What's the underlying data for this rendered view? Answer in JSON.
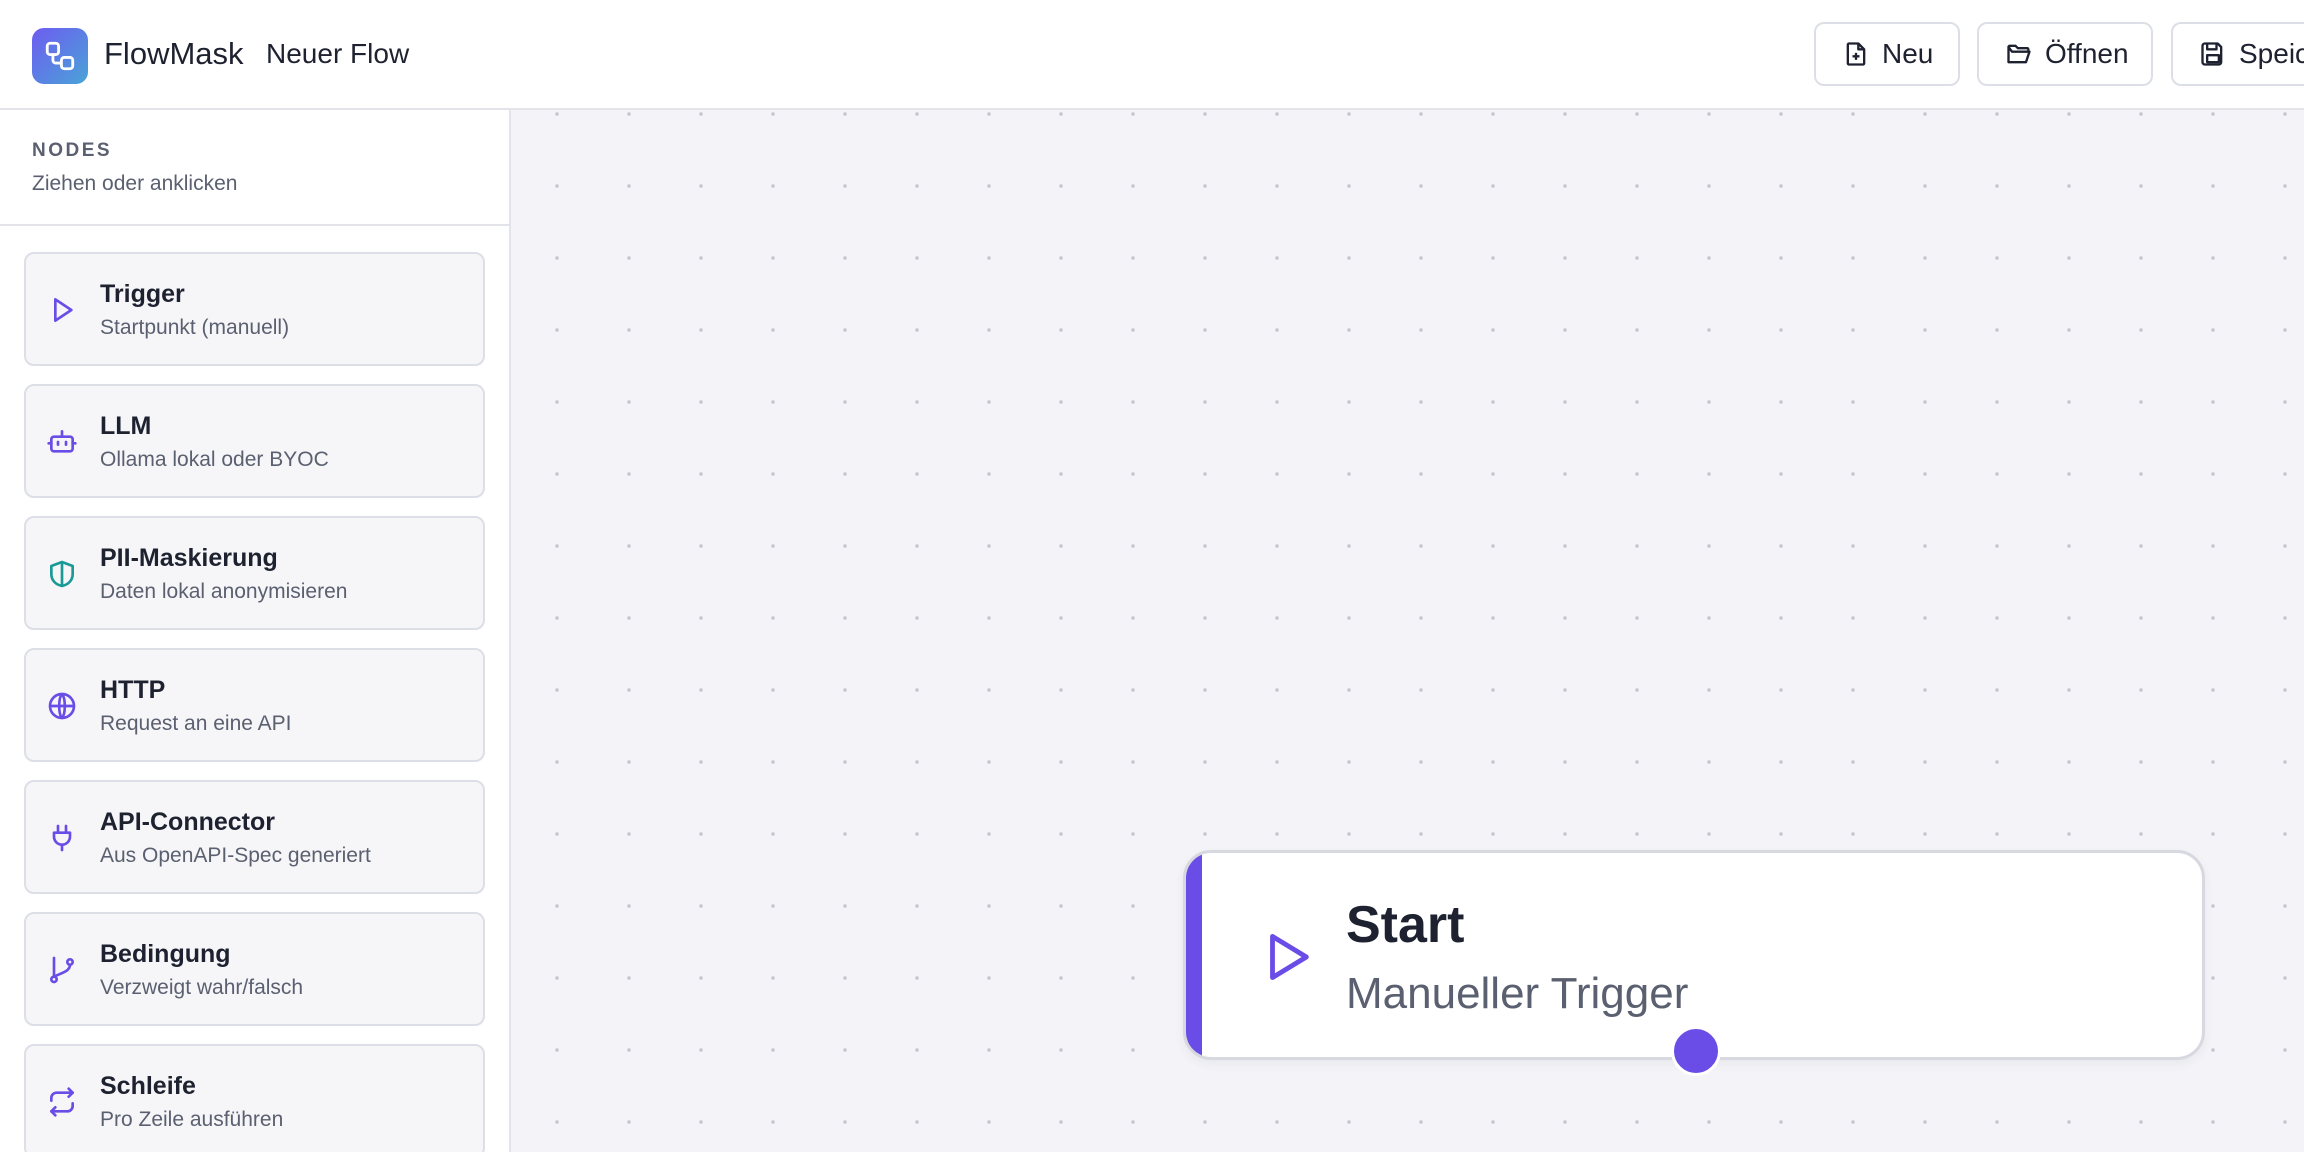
{
  "header": {
    "brand": "FlowMask",
    "flow_name": "Neuer Flow",
    "buttons": {
      "new_label": "Neu",
      "open_label": "Öffnen",
      "save_label": "Speic"
    }
  },
  "sidebar": {
    "title": "NODES",
    "subtitle": "Ziehen oder anklicken",
    "items": [
      {
        "title": "Trigger",
        "desc": "Startpunkt (manuell)",
        "icon": "play-icon"
      },
      {
        "title": "LLM",
        "desc": "Ollama lokal oder BYOC",
        "icon": "robot-icon"
      },
      {
        "title": "PII-Maskierung",
        "desc": "Daten lokal anonymisieren",
        "icon": "shield-icon"
      },
      {
        "title": "HTTP",
        "desc": "Request an eine API",
        "icon": "globe-icon"
      },
      {
        "title": "API-Connector",
        "desc": "Aus OpenAPI-Spec generiert",
        "icon": "plug-icon"
      },
      {
        "title": "Bedingung",
        "desc": "Verzweigt wahr/falsch",
        "icon": "branch-icon"
      },
      {
        "title": "Schleife",
        "desc": "Pro Zeile ausführen",
        "icon": "repeat-icon"
      }
    ]
  },
  "canvas": {
    "node": {
      "title": "Start",
      "subtitle": "Manueller Trigger",
      "icon": "play-icon"
    }
  },
  "colors": {
    "accent": "#6a4de6",
    "teal": "#1a9a94",
    "canvas_bg": "#f4f4f8"
  }
}
